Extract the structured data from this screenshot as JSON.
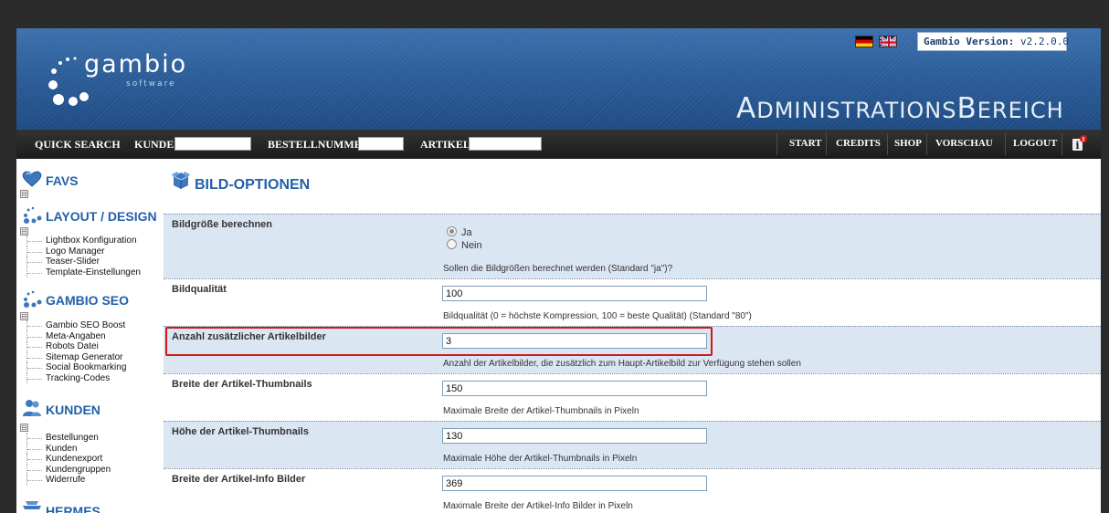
{
  "header": {
    "logo_word": "gambio",
    "logo_sub": "software",
    "version_label": "Gambio Version:",
    "version_value": "v2.2.0.0",
    "admin_title_A": "A",
    "admin_title_1": "DMINISTRATIONS",
    "admin_title_B": "B",
    "admin_title_2": "EREICH",
    "brand_color": "#2c5e99"
  },
  "toolbar": {
    "quick_search": "QUICK SEARCH",
    "kunde_label": "KUNDE:",
    "kunde_value": "",
    "bestellnummer_label": "BESTELLNUMMER:",
    "bestellnummer_value": "",
    "artikel_label": "ARTIKEL:",
    "artikel_value": "",
    "nav": [
      "START",
      "CREDITS",
      "SHOP",
      "VORSCHAU",
      "LOGOUT"
    ]
  },
  "sidebar": {
    "favs": "FAVS",
    "layout_design": "LAYOUT / DESIGN",
    "layout_items": [
      "Lightbox Konfiguration",
      "Logo Manager",
      "Teaser-Slider",
      "Template-Einstellungen"
    ],
    "gambio_seo": "GAMBIO SEO",
    "seo_items": [
      "Gambio SEO Boost",
      "Meta-Angaben",
      "Robots Datei",
      "Sitemap Generator",
      "Social Bookmarking",
      "Tracking-Codes"
    ],
    "kunden": "KUNDEN",
    "kunden_items": [
      "Bestellungen",
      "Kunden",
      "Kundenexport",
      "Kundengruppen",
      "Widerrufe"
    ],
    "hermes": "HERMES",
    "toggle_symbol": "⊟"
  },
  "main": {
    "title": "BILD-OPTIONEN",
    "rows": [
      {
        "label": "Bildgröße berechnen",
        "options": [
          "Ja",
          "Nein"
        ],
        "selected": "Ja",
        "desc": "Sollen die Bildgrößen berechnet werden (Standard \"ja\")?"
      },
      {
        "label": "Bildqualität",
        "value": "100",
        "desc": "Bildqualität (0 = höchste Kompression, 100 = beste Qualität) (Standard \"80\")"
      },
      {
        "label": "Anzahl zusätzlicher Artikelbilder",
        "value": "3",
        "desc": "Anzahl der Artikelbilder, die zusätzlich zum Haupt-Artikelbild zur Verfügung stehen sollen"
      },
      {
        "label": "Breite der Artikel-Thumbnails",
        "value": "150",
        "desc": "Maximale Breite der Artikel-Thumbnails in Pixeln"
      },
      {
        "label": "Höhe der Artikel-Thumbnails",
        "value": "130",
        "desc": "Maximale Höhe der Artikel-Thumbnails in Pixeln"
      },
      {
        "label": "Breite der Artikel-Info Bilder",
        "value": "369",
        "desc": "Maximale Breite der Artikel-Info Bilder in Pixeln"
      }
    ],
    "highlight_color": "#d21818"
  }
}
